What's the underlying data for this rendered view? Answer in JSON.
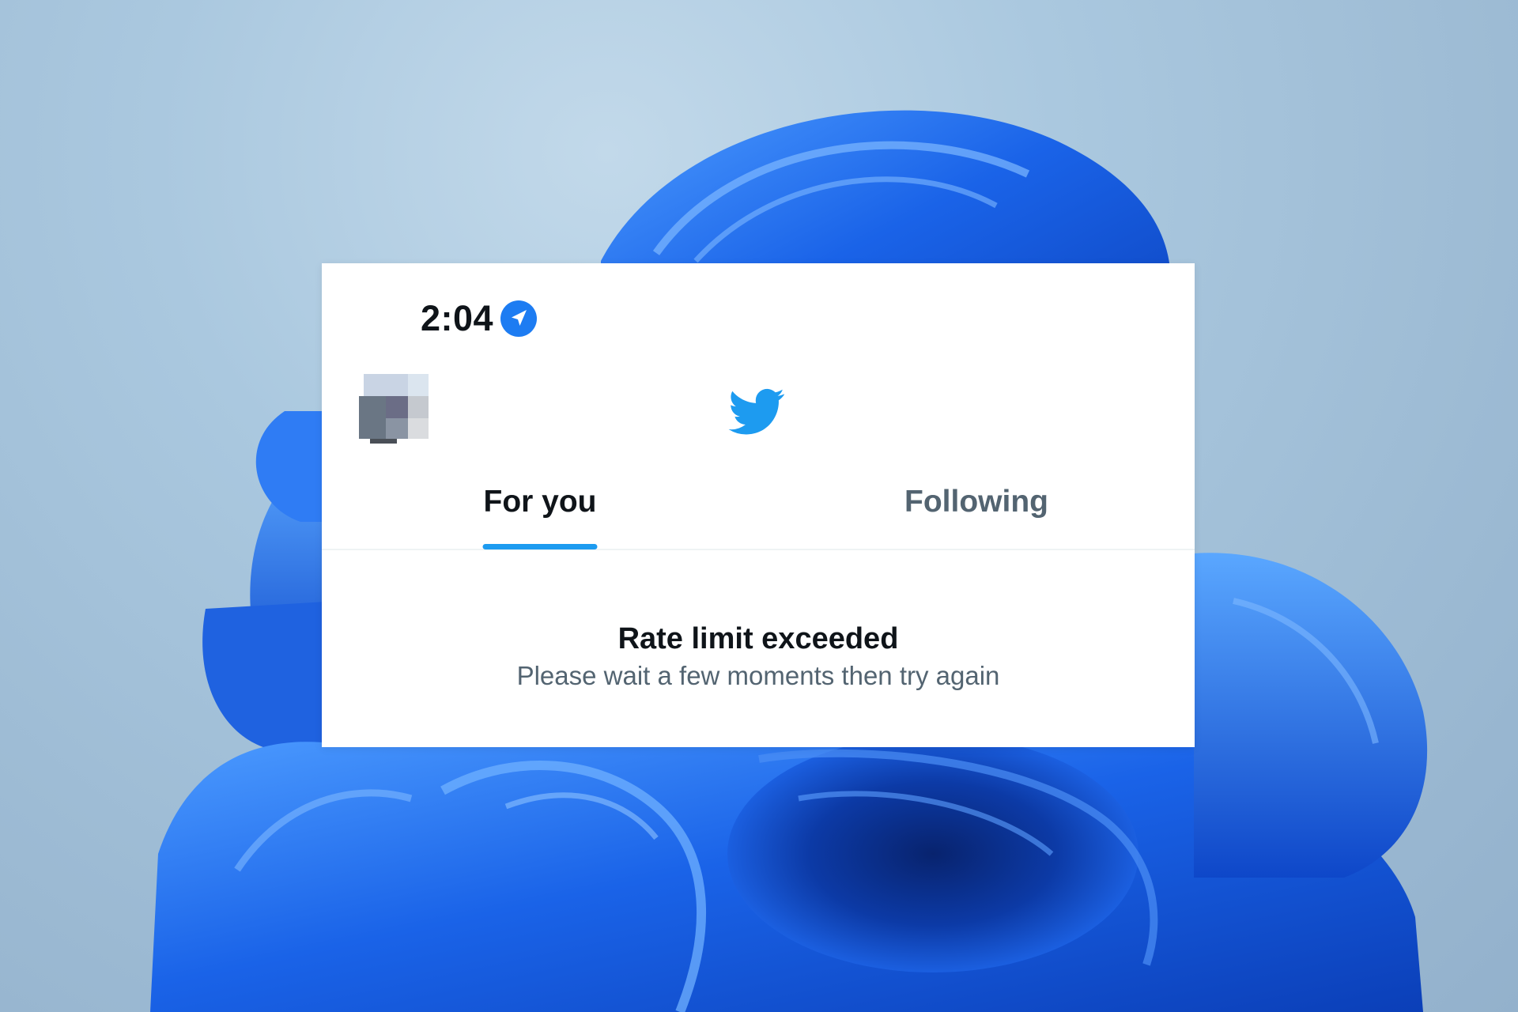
{
  "status_bar": {
    "time": "2:04",
    "location_icon": "location-arrow-icon"
  },
  "header": {
    "avatar": "avatar",
    "logo_icon": "twitter-bird-icon",
    "brand_color": "#1d9bf0"
  },
  "tabs": [
    {
      "label": "For you",
      "active": true
    },
    {
      "label": "Following",
      "active": false
    }
  ],
  "error": {
    "title": "Rate limit exceeded",
    "subtitle": "Please wait a few moments then try again"
  }
}
